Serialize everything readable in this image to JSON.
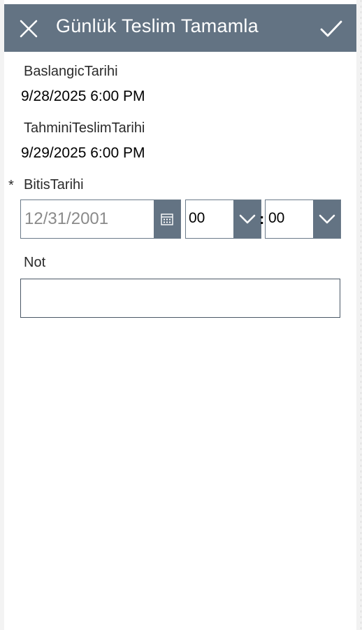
{
  "header": {
    "title": "Günlük Teslim Tamamla",
    "close_icon": "close-icon",
    "confirm_icon": "checkmark-icon",
    "color": "#637383"
  },
  "fields": {
    "start": {
      "label": "BaslangicTarihi",
      "value": "9/28/2025 6:00 PM"
    },
    "estimated": {
      "label": "TahminiTeslimTarihi",
      "value": "9/29/2025 6:00 PM"
    },
    "end": {
      "required_marker": "*",
      "label": "BitisTarihi",
      "date_placeholder": "12/31/2001",
      "calendar_icon": "calendar-icon",
      "hour": "00",
      "separator": ":",
      "minute": "00",
      "chevron_icon": "chevron-down-icon"
    },
    "note": {
      "label": "Not",
      "value": ""
    }
  }
}
